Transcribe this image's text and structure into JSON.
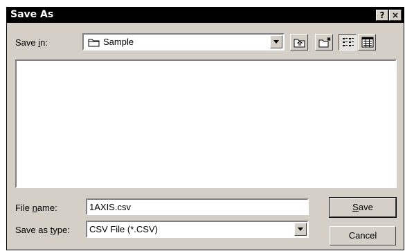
{
  "window": {
    "title": "Save As",
    "help_label": "?",
    "close_label": "×"
  },
  "save_in": {
    "label_pre": "Save ",
    "label_key": "i",
    "label_post": "n:",
    "value": "Sample"
  },
  "file_name": {
    "label_pre": "File ",
    "label_key": "n",
    "label_post": "ame:",
    "value": "1AXIS.csv"
  },
  "save_as_type": {
    "label_pre": "Save as ",
    "label_key": "t",
    "label_post": "ype:",
    "value": "CSV File (*.CSV)"
  },
  "buttons": {
    "save_key": "S",
    "save_rest": "ave",
    "cancel": "Cancel"
  },
  "toolbar_icons": [
    "up-one-level-icon",
    "create-new-folder-icon",
    "list-view-icon",
    "details-view-icon"
  ]
}
